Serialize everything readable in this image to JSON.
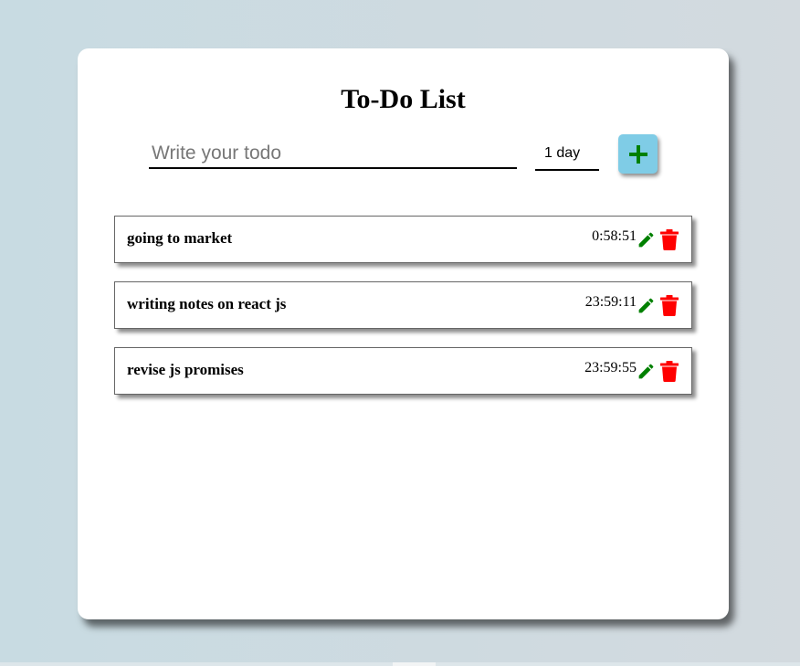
{
  "app": {
    "title": "To-Do List"
  },
  "form": {
    "todo_placeholder": "Write your todo",
    "todo_value": "",
    "duration_value": "1 day",
    "add_icon": "plus-icon"
  },
  "todos": [
    {
      "text": "going to market",
      "timer": "0:58:51",
      "edit_icon": "pencil-icon",
      "delete_icon": "trash-icon"
    },
    {
      "text": "writing notes on react js",
      "timer": "23:59:11",
      "edit_icon": "pencil-icon",
      "delete_icon": "trash-icon"
    },
    {
      "text": "revise js promises",
      "timer": "23:59:55",
      "edit_icon": "pencil-icon",
      "delete_icon": "trash-icon"
    }
  ],
  "colors": {
    "accent_button": "#7fcce6",
    "plus_icon": "#008000",
    "edit_icon": "#008000",
    "delete_icon": "#ff0000"
  }
}
